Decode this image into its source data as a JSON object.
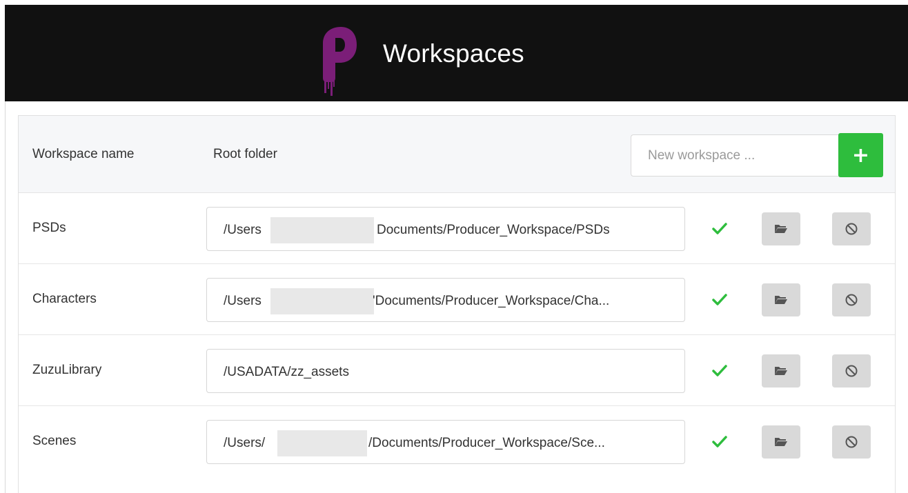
{
  "header": {
    "title": "Workspaces",
    "logo_color": "#7b1e78"
  },
  "table": {
    "col_name": "Workspace name",
    "col_root": "Root folder",
    "new_workspace_placeholder": "New workspace ...",
    "add_label": "+",
    "accent": "#2ebd3d",
    "rows": [
      {
        "name": "PSDs",
        "path_start": "/Users",
        "path_end": "Documents/Producer_Workspace/PSDs",
        "status_icon": "check-icon"
      },
      {
        "name": "Characters",
        "path_start": "/Users",
        "path_end": "'Documents/Producer_Workspace/Cha...",
        "status_icon": "check-icon"
      },
      {
        "name": "ZuzuLibrary",
        "path_start": "/USADATA/zz_assets",
        "path_end": "",
        "status_icon": "check-icon"
      },
      {
        "name": "Scenes",
        "path_start": "/Users/",
        "path_end": "/Documents/Producer_Workspace/Sce...",
        "status_icon": "check-icon"
      }
    ]
  }
}
